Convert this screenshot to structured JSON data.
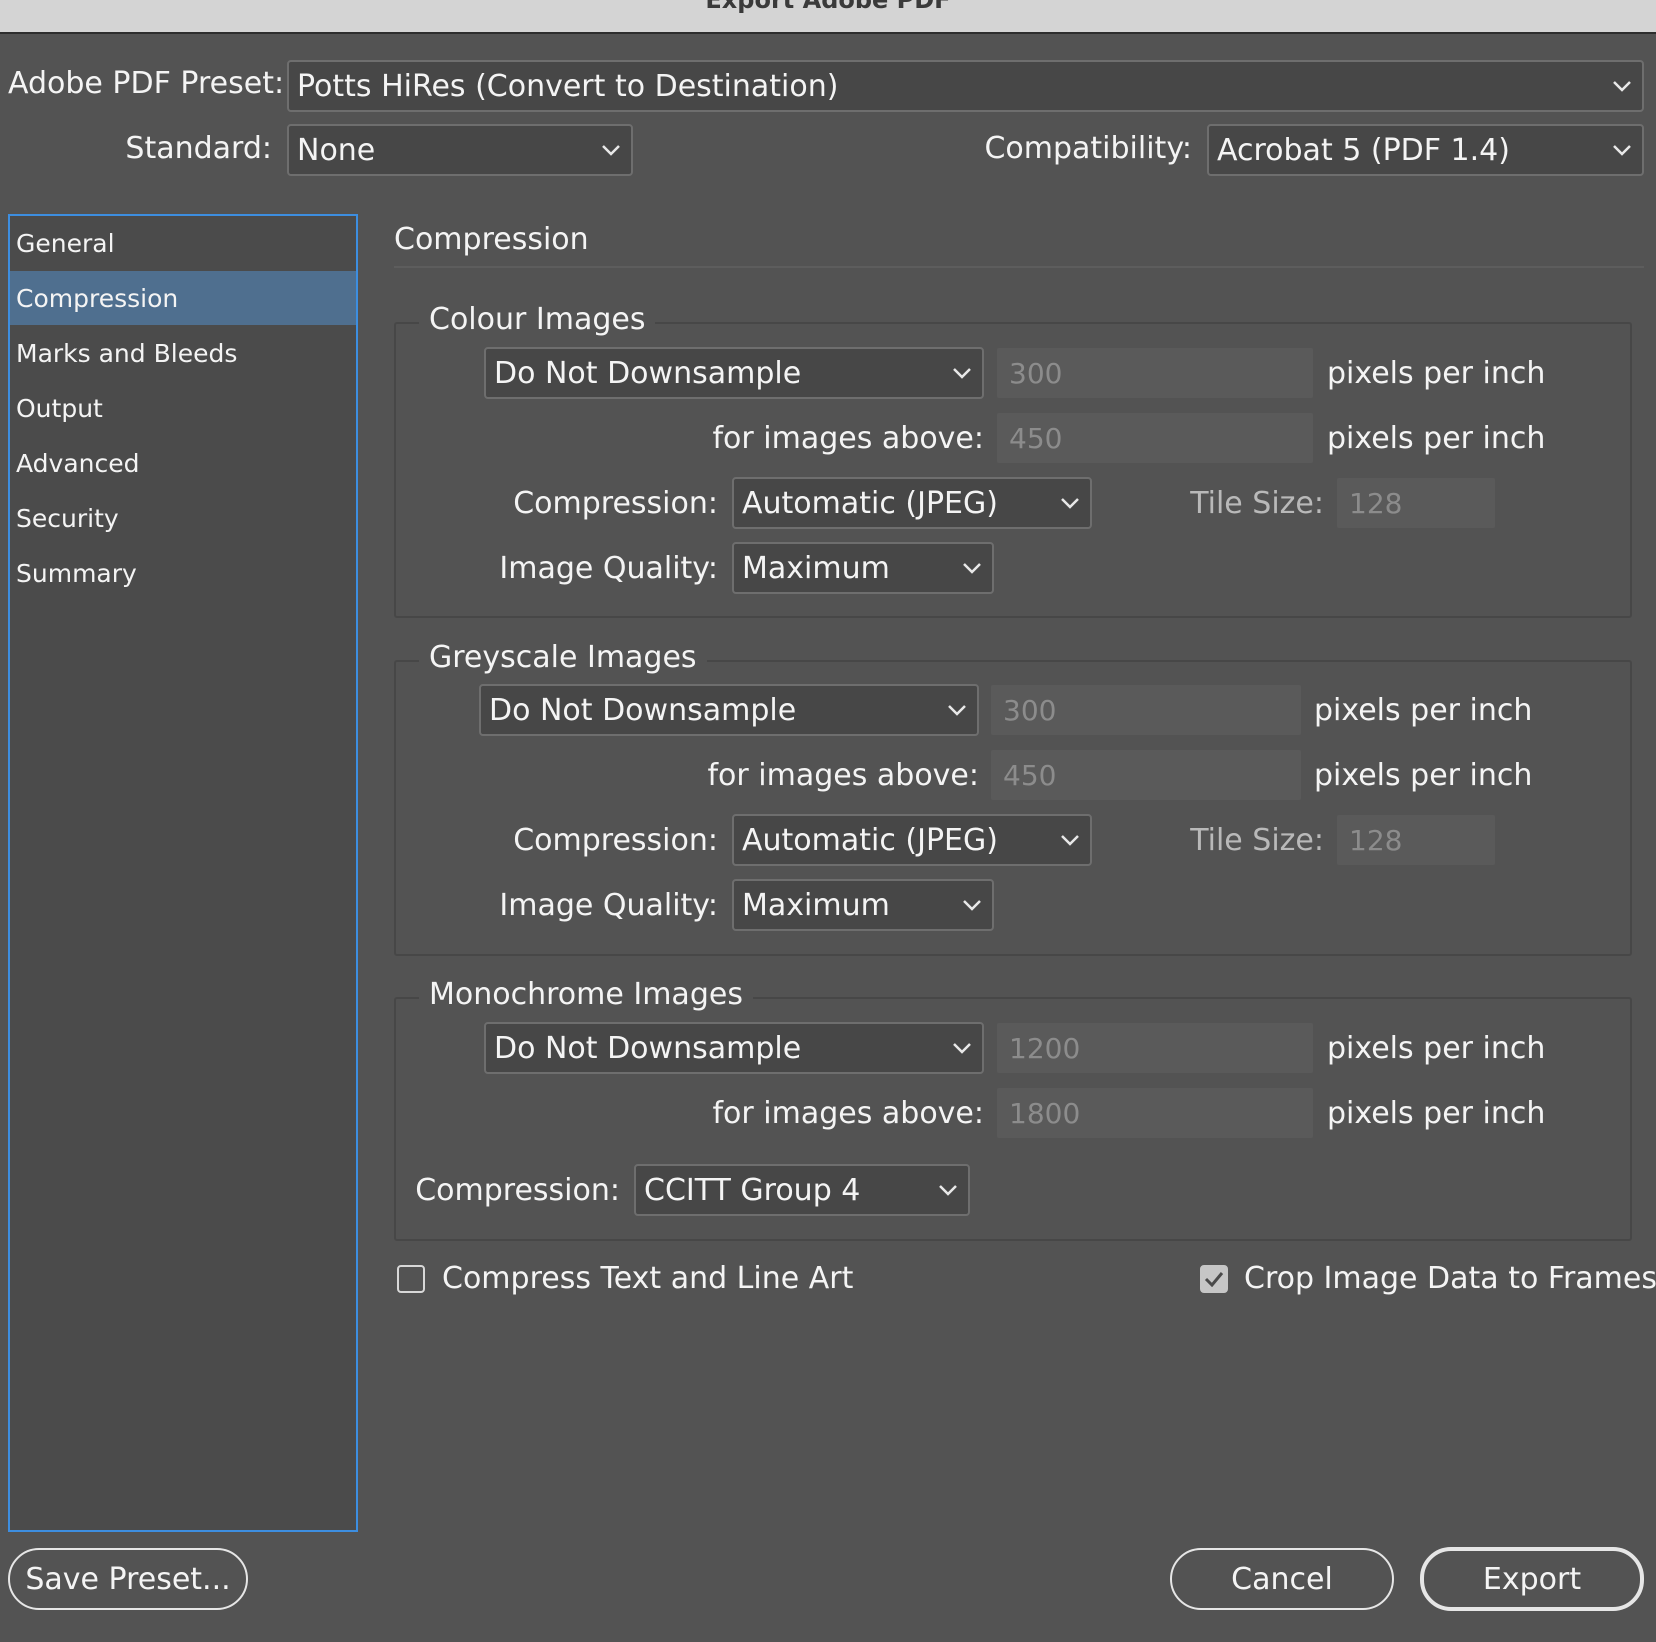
{
  "window": {
    "title": "Export Adobe PDF"
  },
  "preset": {
    "label": "Adobe PDF Preset:",
    "value": "Potts HiRes (Convert to Destination)"
  },
  "standard": {
    "label": "Standard:",
    "value": "None"
  },
  "compatibility": {
    "label": "Compatibility:",
    "value": "Acrobat 5 (PDF 1.4)"
  },
  "sidebar": {
    "items": [
      {
        "label": "General"
      },
      {
        "label": "Compression"
      },
      {
        "label": "Marks and Bleeds"
      },
      {
        "label": "Output"
      },
      {
        "label": "Advanced"
      },
      {
        "label": "Security"
      },
      {
        "label": "Summary"
      }
    ],
    "selected": "Compression"
  },
  "panel": {
    "title": "Compression"
  },
  "colour": {
    "legend": "Colour Images",
    "downsample": "Do Not Downsample",
    "resolution": "300",
    "above_label": "for images above:",
    "above": "450",
    "ppi_label": "pixels per inch",
    "compression_label": "Compression:",
    "compression": "Automatic (JPEG)",
    "tile_label": "Tile Size:",
    "tile": "128",
    "quality_label": "Image Quality:",
    "quality": "Maximum"
  },
  "greyscale": {
    "legend": "Greyscale Images",
    "downsample": "Do Not Downsample",
    "resolution": "300",
    "above_label": "for images above:",
    "above": "450",
    "ppi_label": "pixels per inch",
    "compression_label": "Compression:",
    "compression": "Automatic (JPEG)",
    "tile_label": "Tile Size:",
    "tile": "128",
    "quality_label": "Image Quality:",
    "quality": "Maximum"
  },
  "monochrome": {
    "legend": "Monochrome Images",
    "downsample": "Do Not Downsample",
    "resolution": "1200",
    "above_label": "for images above:",
    "above": "1800",
    "ppi_label": "pixels per inch",
    "compression_label": "Compression:",
    "compression": "CCITT Group 4"
  },
  "options": {
    "compress_text": {
      "label": "Compress Text and Line Art",
      "checked": false
    },
    "crop_image": {
      "label": "Crop Image Data to Frames",
      "checked": true
    }
  },
  "buttons": {
    "save_preset": "Save Preset...",
    "cancel": "Cancel",
    "export": "Export"
  },
  "colors": {
    "background": "#535353",
    "selection": "#4f6f8f",
    "focus_ring": "#3d8ee0"
  }
}
